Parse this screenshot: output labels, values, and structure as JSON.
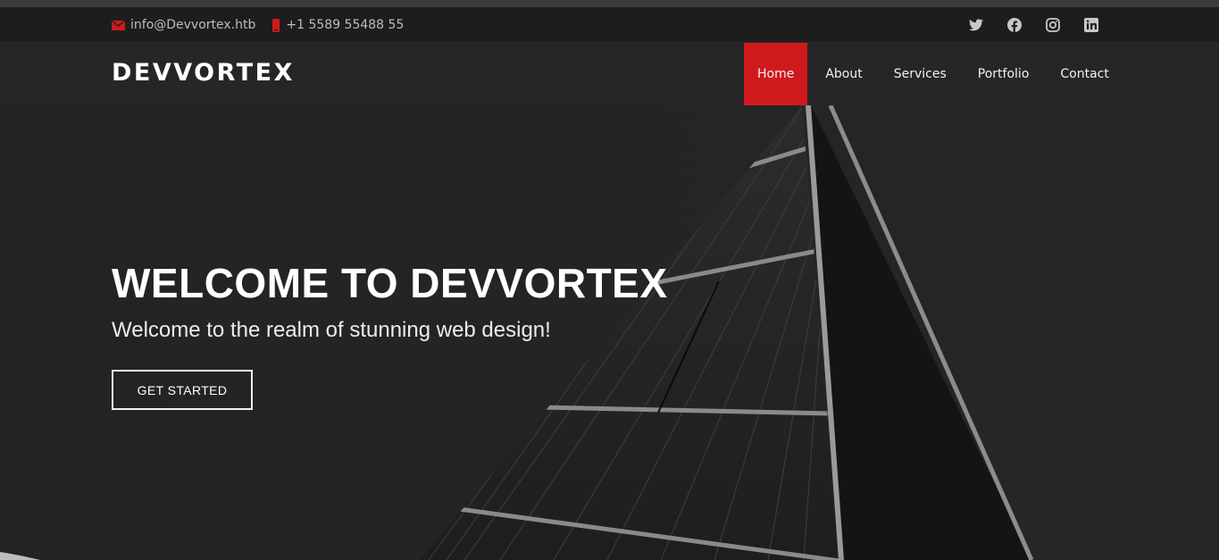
{
  "topbar": {
    "email": "info@Devvortex.htb",
    "phone": "+1 5589 55488 55",
    "social": [
      {
        "icon": "twitter-icon"
      },
      {
        "icon": "facebook-icon"
      },
      {
        "icon": "instagram-icon"
      },
      {
        "icon": "linkedin-icon"
      }
    ]
  },
  "header": {
    "logo": "DEVVORTEX",
    "nav": [
      "Home",
      "About",
      "Services",
      "Portfolio",
      "Contact"
    ],
    "active": "Home"
  },
  "hero": {
    "title": "WELCOME TO DEVVORTEX",
    "subtitle": "Welcome to the realm of stunning web design!",
    "button": "GET STARTED"
  },
  "colors": {
    "accent": "#d0191d",
    "topbar_bg": "#1d1d1d",
    "header_bg": "#262626",
    "hero_bg": "#232323",
    "text": "#ffffff"
  }
}
